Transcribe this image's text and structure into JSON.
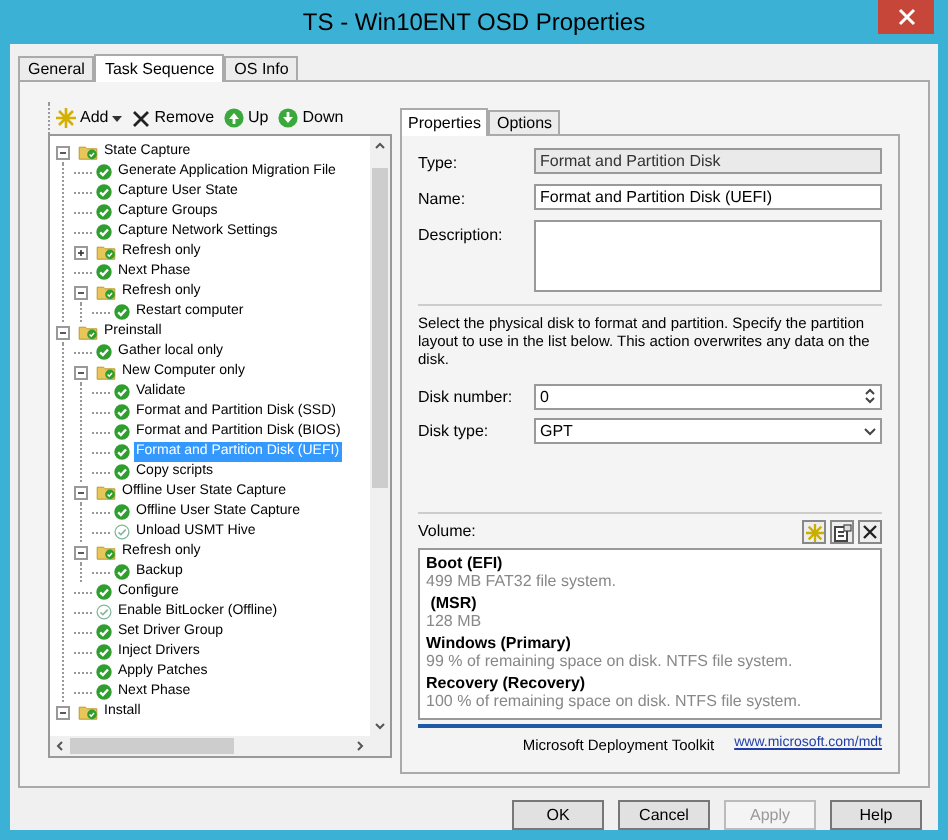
{
  "window": {
    "title": "TS - Win10ENT OSD Properties"
  },
  "tabs": [
    {
      "label": "General",
      "selected": false
    },
    {
      "label": "Task Sequence",
      "selected": true
    },
    {
      "label": "OS Info",
      "selected": false
    }
  ],
  "toolbar": [
    {
      "kind": "add",
      "label": "Add"
    },
    {
      "kind": "remove",
      "label": "Remove"
    },
    {
      "kind": "up",
      "label": "Up"
    },
    {
      "kind": "down",
      "label": "Down"
    }
  ],
  "tree": [
    {
      "kind": "group",
      "label": "State Capture",
      "expanded": true,
      "selected": false,
      "children": [
        {
          "kind": "step",
          "label": "Generate Application Migration File",
          "disabled": false,
          "selected": false
        },
        {
          "kind": "step",
          "label": "Capture User State",
          "disabled": false,
          "selected": false
        },
        {
          "kind": "step",
          "label": "Capture Groups",
          "disabled": false,
          "selected": false
        },
        {
          "kind": "step",
          "label": "Capture Network Settings",
          "disabled": false,
          "selected": false
        },
        {
          "kind": "group",
          "label": "Refresh only",
          "expanded": false,
          "selected": false
        },
        {
          "kind": "step",
          "label": "Next Phase",
          "disabled": false,
          "selected": false
        },
        {
          "kind": "group",
          "label": "Refresh only",
          "expanded": true,
          "selected": false,
          "children": [
            {
              "kind": "step",
              "label": "Restart computer",
              "disabled": false,
              "selected": false
            }
          ]
        }
      ]
    },
    {
      "kind": "group",
      "label": "Preinstall",
      "expanded": true,
      "selected": false,
      "children": [
        {
          "kind": "step",
          "label": "Gather local only",
          "disabled": false,
          "selected": false
        },
        {
          "kind": "group",
          "label": "New Computer only",
          "expanded": true,
          "selected": false,
          "children": [
            {
              "kind": "step",
              "label": "Validate",
              "disabled": false,
              "selected": false
            },
            {
              "kind": "step",
              "label": "Format and Partition Disk (SSD)",
              "disabled": false,
              "selected": false
            },
            {
              "kind": "step",
              "label": "Format and Partition Disk (BIOS)",
              "disabled": false,
              "selected": false
            },
            {
              "kind": "step",
              "label": "Format and Partition Disk (UEFI)",
              "disabled": false,
              "selected": true
            },
            {
              "kind": "step",
              "label": "Copy scripts",
              "disabled": false,
              "selected": false
            }
          ]
        },
        {
          "kind": "group",
          "label": "Offline User State Capture",
          "expanded": true,
          "selected": false,
          "children": [
            {
              "kind": "step",
              "label": "Offline User State Capture",
              "disabled": false,
              "selected": false
            },
            {
              "kind": "step",
              "label": "Unload USMT Hive",
              "disabled": true,
              "selected": false
            }
          ]
        },
        {
          "kind": "group",
          "label": "Refresh only",
          "expanded": true,
          "selected": false,
          "children": [
            {
              "kind": "step",
              "label": "Backup",
              "disabled": false,
              "selected": false
            }
          ]
        },
        {
          "kind": "step",
          "label": "Configure",
          "disabled": false,
          "selected": false
        },
        {
          "kind": "step",
          "label": "Enable BitLocker (Offline)",
          "disabled": true,
          "selected": false
        },
        {
          "kind": "step",
          "label": "Set Driver Group",
          "disabled": false,
          "selected": false
        },
        {
          "kind": "step",
          "label": "Inject Drivers",
          "disabled": false,
          "selected": false
        },
        {
          "kind": "step",
          "label": "Apply Patches",
          "disabled": false,
          "selected": false
        },
        {
          "kind": "step",
          "label": "Next Phase",
          "disabled": false,
          "selected": false
        }
      ]
    },
    {
      "kind": "group",
      "label": "Install",
      "expanded": true,
      "selected": false
    }
  ],
  "properties": {
    "tabs": [
      {
        "label": "Properties",
        "selected": true
      },
      {
        "label": "Options",
        "selected": false
      }
    ],
    "fields": [
      {
        "kind": "readonly",
        "label": "Type:",
        "value": "Format and Partition Disk"
      },
      {
        "kind": "text",
        "label": "Name:",
        "value": "Format and Partition Disk (UEFI)"
      },
      {
        "kind": "textarea",
        "label": "Description:"
      }
    ],
    "instructions": "Select the physical disk to format and partition.  Specify the partition layout to use in the list below. This action overwrites any data on the disk.",
    "disk_number": {
      "label": "Disk number:",
      "value": "0"
    },
    "disk_type": {
      "label": "Disk type:",
      "value": "GPT"
    },
    "volume": {
      "label": "Volume:",
      "items": [
        {
          "name": "Boot (EFI)",
          "detail": "499 MB FAT32 file system."
        },
        {
          "name": " (MSR)",
          "detail": "128 MB"
        },
        {
          "name": "Windows (Primary)",
          "detail": "99 % of remaining space on disk. NTFS file system."
        },
        {
          "name": "Recovery (Recovery)",
          "detail": "100 % of remaining space on disk. NTFS file system."
        }
      ]
    },
    "footer": {
      "product": "Microsoft Deployment Toolkit",
      "link": "www.microsoft.com/mdt"
    }
  },
  "buttons": [
    {
      "label": "OK",
      "disabled": false
    },
    {
      "label": "Cancel",
      "disabled": false
    },
    {
      "label": "Apply",
      "disabled": true
    },
    {
      "label": "Help",
      "disabled": false
    }
  ]
}
